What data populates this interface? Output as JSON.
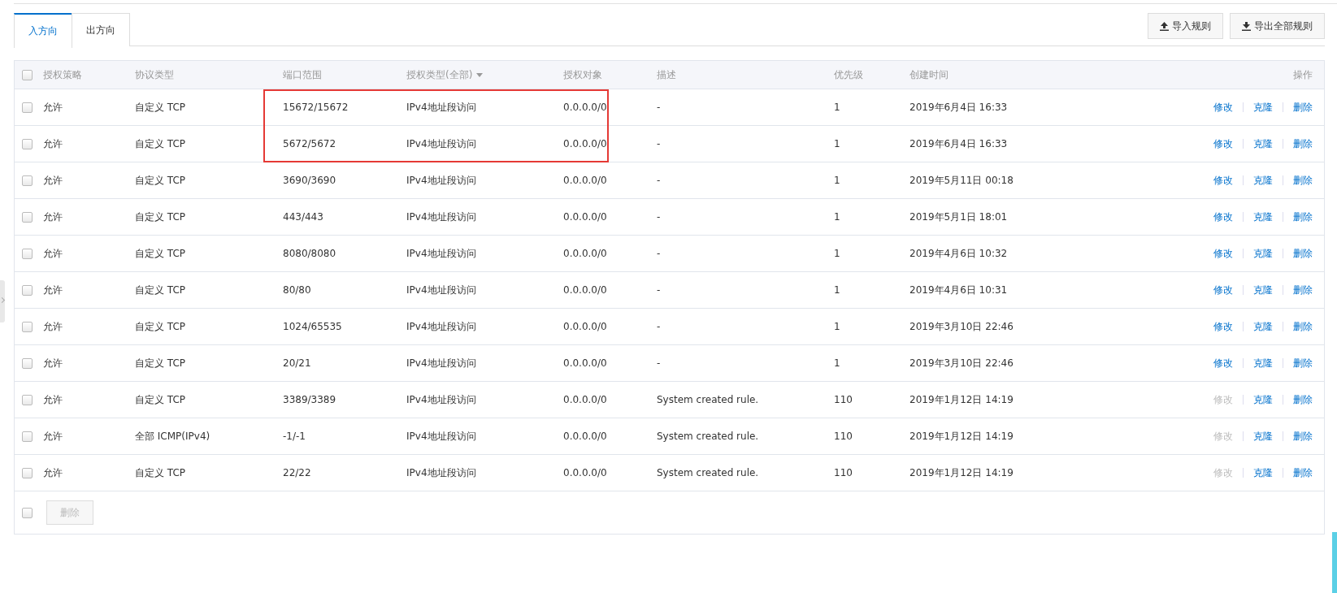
{
  "tabs": [
    {
      "label": "入方向",
      "selected": true
    },
    {
      "label": "出方向",
      "selected": false
    }
  ],
  "toolbar_buttons": [
    {
      "label": "导入规则",
      "kind": "upload"
    },
    {
      "label": "导出全部规则",
      "kind": "download"
    }
  ],
  "table": {
    "select_all_checked": false,
    "columns": [
      "授权策略",
      "协议类型",
      "端口范围",
      "授权类型(全部)",
      "授权对象",
      "描述",
      "优先级",
      "创建时间",
      "操作"
    ],
    "rows": [
      {
        "checked": false,
        "policy": "允许",
        "protocol": "自定义 TCP",
        "ports": "15672/15672",
        "auth_type": "IPv4地址段访问",
        "target": "0.0.0.0/0",
        "description": "-",
        "priority": "1",
        "created": "2019年6月4日 16:33",
        "actions": [
          "修改",
          "克隆",
          "删除"
        ],
        "edit_disabled": false,
        "highlighted": true
      },
      {
        "checked": false,
        "policy": "允许",
        "protocol": "自定义 TCP",
        "ports": "5672/5672",
        "auth_type": "IPv4地址段访问",
        "target": "0.0.0.0/0",
        "description": "-",
        "priority": "1",
        "created": "2019年6月4日 16:33",
        "actions": [
          "修改",
          "克隆",
          "删除"
        ],
        "edit_disabled": false,
        "highlighted": true
      },
      {
        "checked": false,
        "policy": "允许",
        "protocol": "自定义 TCP",
        "ports": "3690/3690",
        "auth_type": "IPv4地址段访问",
        "target": "0.0.0.0/0",
        "description": "-",
        "priority": "1",
        "created": "2019年5月11日 00:18",
        "actions": [
          "修改",
          "克隆",
          "删除"
        ],
        "edit_disabled": false,
        "highlighted": false
      },
      {
        "checked": false,
        "policy": "允许",
        "protocol": "自定义 TCP",
        "ports": "443/443",
        "auth_type": "IPv4地址段访问",
        "target": "0.0.0.0/0",
        "description": "-",
        "priority": "1",
        "created": "2019年5月1日 18:01",
        "actions": [
          "修改",
          "克隆",
          "删除"
        ],
        "edit_disabled": false,
        "highlighted": false
      },
      {
        "checked": false,
        "policy": "允许",
        "protocol": "自定义 TCP",
        "ports": "8080/8080",
        "auth_type": "IPv4地址段访问",
        "target": "0.0.0.0/0",
        "description": "-",
        "priority": "1",
        "created": "2019年4月6日 10:32",
        "actions": [
          "修改",
          "克隆",
          "删除"
        ],
        "edit_disabled": false,
        "highlighted": false
      },
      {
        "checked": false,
        "policy": "允许",
        "protocol": "自定义 TCP",
        "ports": "80/80",
        "auth_type": "IPv4地址段访问",
        "target": "0.0.0.0/0",
        "description": "-",
        "priority": "1",
        "created": "2019年4月6日 10:31",
        "actions": [
          "修改",
          "克隆",
          "删除"
        ],
        "edit_disabled": false,
        "highlighted": false
      },
      {
        "checked": false,
        "policy": "允许",
        "protocol": "自定义 TCP",
        "ports": "1024/65535",
        "auth_type": "IPv4地址段访问",
        "target": "0.0.0.0/0",
        "description": "-",
        "priority": "1",
        "created": "2019年3月10日 22:46",
        "actions": [
          "修改",
          "克隆",
          "删除"
        ],
        "edit_disabled": false,
        "highlighted": false
      },
      {
        "checked": false,
        "policy": "允许",
        "protocol": "自定义 TCP",
        "ports": "20/21",
        "auth_type": "IPv4地址段访问",
        "target": "0.0.0.0/0",
        "description": "-",
        "priority": "1",
        "created": "2019年3月10日 22:46",
        "actions": [
          "修改",
          "克隆",
          "删除"
        ],
        "edit_disabled": false,
        "highlighted": false
      },
      {
        "checked": false,
        "policy": "允许",
        "protocol": "自定义 TCP",
        "ports": "3389/3389",
        "auth_type": "IPv4地址段访问",
        "target": "0.0.0.0/0",
        "description": "System created rule.",
        "priority": "110",
        "created": "2019年1月12日 14:19",
        "actions": [
          "修改",
          "克隆",
          "删除"
        ],
        "edit_disabled": true,
        "highlighted": false
      },
      {
        "checked": false,
        "policy": "允许",
        "protocol": "全部 ICMP(IPv4)",
        "ports": "-1/-1",
        "auth_type": "IPv4地址段访问",
        "target": "0.0.0.0/0",
        "description": "System created rule.",
        "priority": "110",
        "created": "2019年1月12日 14:19",
        "actions": [
          "修改",
          "克隆",
          "删除"
        ],
        "edit_disabled": true,
        "highlighted": false
      },
      {
        "checked": false,
        "policy": "允许",
        "protocol": "自定义 TCP",
        "ports": "22/22",
        "auth_type": "IPv4地址段访问",
        "target": "0.0.0.0/0",
        "description": "System created rule.",
        "priority": "110",
        "created": "2019年1月12日 14:19",
        "actions": [
          "修改",
          "克隆",
          "删除"
        ],
        "edit_disabled": true,
        "highlighted": false
      }
    ]
  },
  "footer": {
    "select_checked": false,
    "delete_button": {
      "label": "删除",
      "disabled": true
    }
  }
}
